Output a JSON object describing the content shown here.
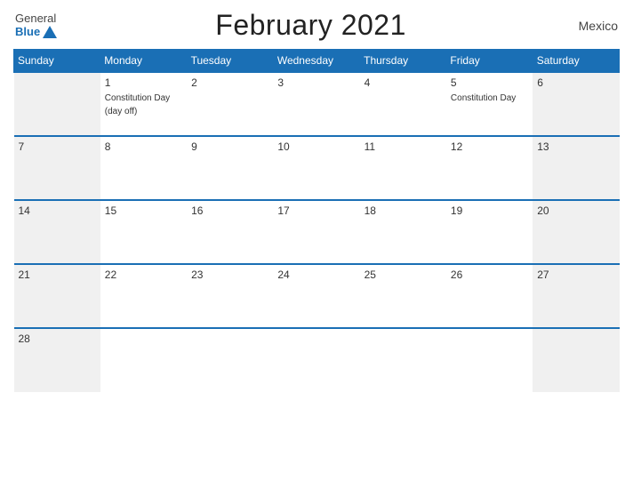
{
  "header": {
    "title": "February 2021",
    "country": "Mexico",
    "logo_general": "General",
    "logo_blue": "Blue"
  },
  "days_header": [
    "Sunday",
    "Monday",
    "Tuesday",
    "Wednesday",
    "Thursday",
    "Friday",
    "Saturday"
  ],
  "weeks": [
    [
      {
        "num": "",
        "event": "",
        "type": "empty"
      },
      {
        "num": "1",
        "event": "Constitution Day\n(day off)",
        "type": "normal"
      },
      {
        "num": "2",
        "event": "",
        "type": "normal"
      },
      {
        "num": "3",
        "event": "",
        "type": "normal"
      },
      {
        "num": "4",
        "event": "",
        "type": "normal"
      },
      {
        "num": "5",
        "event": "Constitution Day",
        "type": "normal"
      },
      {
        "num": "6",
        "event": "",
        "type": "weekend"
      }
    ],
    [
      {
        "num": "7",
        "event": "",
        "type": "weekend"
      },
      {
        "num": "8",
        "event": "",
        "type": "normal"
      },
      {
        "num": "9",
        "event": "",
        "type": "normal"
      },
      {
        "num": "10",
        "event": "",
        "type": "normal"
      },
      {
        "num": "11",
        "event": "",
        "type": "normal"
      },
      {
        "num": "12",
        "event": "",
        "type": "normal"
      },
      {
        "num": "13",
        "event": "",
        "type": "weekend"
      }
    ],
    [
      {
        "num": "14",
        "event": "",
        "type": "weekend"
      },
      {
        "num": "15",
        "event": "",
        "type": "normal"
      },
      {
        "num": "16",
        "event": "",
        "type": "normal"
      },
      {
        "num": "17",
        "event": "",
        "type": "normal"
      },
      {
        "num": "18",
        "event": "",
        "type": "normal"
      },
      {
        "num": "19",
        "event": "",
        "type": "normal"
      },
      {
        "num": "20",
        "event": "",
        "type": "weekend"
      }
    ],
    [
      {
        "num": "21",
        "event": "",
        "type": "weekend"
      },
      {
        "num": "22",
        "event": "",
        "type": "normal"
      },
      {
        "num": "23",
        "event": "",
        "type": "normal"
      },
      {
        "num": "24",
        "event": "",
        "type": "normal"
      },
      {
        "num": "25",
        "event": "",
        "type": "normal"
      },
      {
        "num": "26",
        "event": "",
        "type": "normal"
      },
      {
        "num": "27",
        "event": "",
        "type": "weekend"
      }
    ],
    [
      {
        "num": "28",
        "event": "",
        "type": "weekend"
      },
      {
        "num": "",
        "event": "",
        "type": "empty"
      },
      {
        "num": "",
        "event": "",
        "type": "empty"
      },
      {
        "num": "",
        "event": "",
        "type": "empty"
      },
      {
        "num": "",
        "event": "",
        "type": "empty"
      },
      {
        "num": "",
        "event": "",
        "type": "empty"
      },
      {
        "num": "",
        "event": "",
        "type": "empty"
      }
    ]
  ]
}
